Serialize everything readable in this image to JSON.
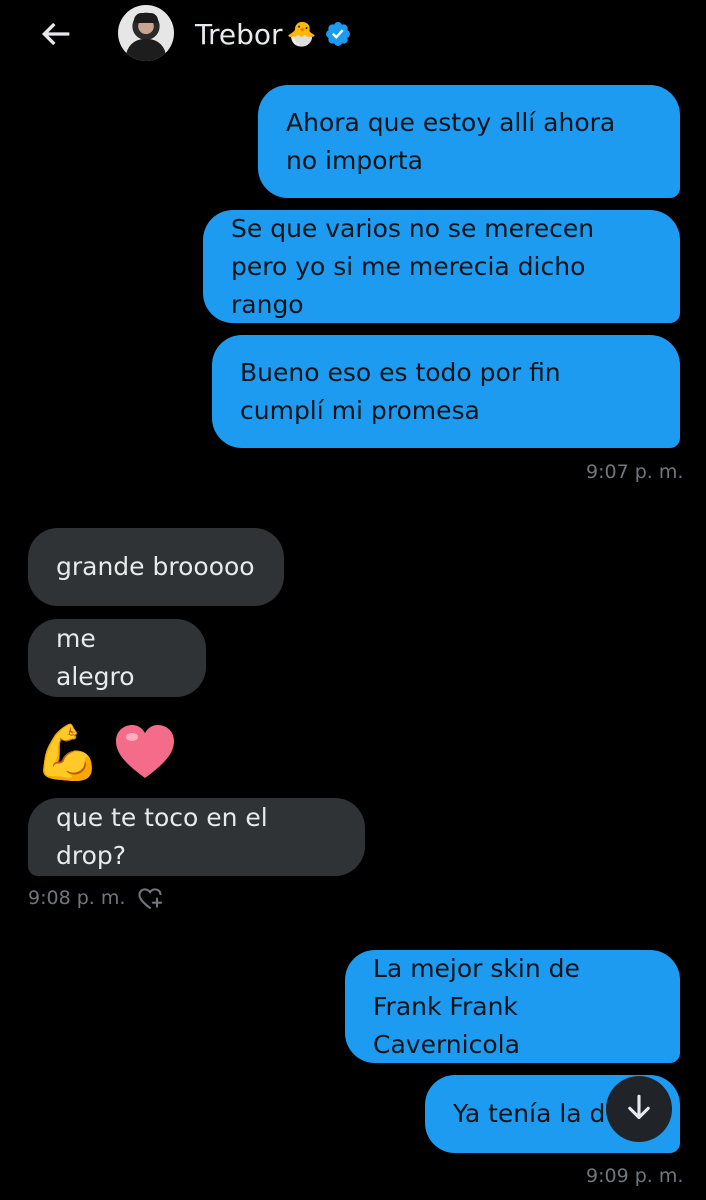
{
  "header": {
    "name": "Trebor",
    "name_emoji": "🐣",
    "back_icon": "arrow-left-icon",
    "verified_icon": "verified-badge-icon",
    "verified_color": "#1d9bf0"
  },
  "messages": {
    "out1": "Ahora que estoy allí ahora no importa",
    "out2": "Se que varios no se merecen pero yo si me merecia dicho rango",
    "out3": "Bueno eso es todo por fin cumplí mi promesa",
    "out_time1": "9:07 p. m.",
    "in1": "grande brooooo",
    "in2": "me alegro",
    "in_emoji1": "💪",
    "in_emoji2": "❤️",
    "in3": "que te toco en el drop?",
    "in_time": "9:08 p. m.",
    "out4": "La mejor skin de Frank Frank Cavernicola",
    "out5": "Ya tenía la d",
    "out_time2": "9:09 p. m."
  },
  "colors": {
    "outgoing_bubble": "#1d9bf0",
    "incoming_bubble": "#2f3336",
    "background": "#000000"
  },
  "icons": {
    "react": "heart-plus-icon",
    "scroll": "arrow-down-icon"
  }
}
